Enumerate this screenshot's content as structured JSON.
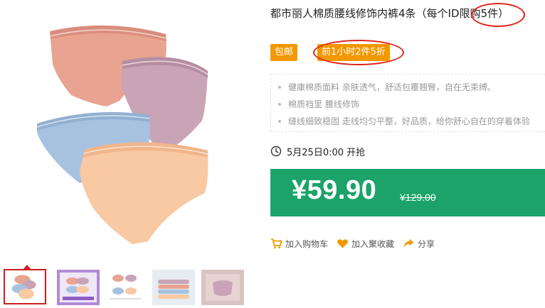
{
  "product": {
    "title": "都市丽人棉质腰线修饰内裤4条（每个ID限购5件）",
    "tags": {
      "postage": "包邮",
      "promo": "前1小时2件5折"
    },
    "features": [
      "健康棉质面料 亲肤透气，舒适包覆翘臀，自在无束缚。",
      "棉质裆里 腰线修饰",
      "缝线细致稳固 走线均匀平整，好品质，给你舒心自在的穿着体验"
    ],
    "schedule": "5月25日0:00 开抢",
    "price": "¥59.90",
    "original_price": "¥129.00"
  },
  "actions": {
    "cart": "加入购物车",
    "favorite": "加入聚收藏",
    "share": "分享"
  },
  "icons": {
    "clock": "clock-icon",
    "cart": "cart-icon",
    "heart": "heart-icon",
    "share": "share-icon"
  },
  "colors": {
    "price_bar": "#1ba36a",
    "tag": "#f39800",
    "annotation": "#e2231a",
    "action_icon": "#f39800"
  }
}
